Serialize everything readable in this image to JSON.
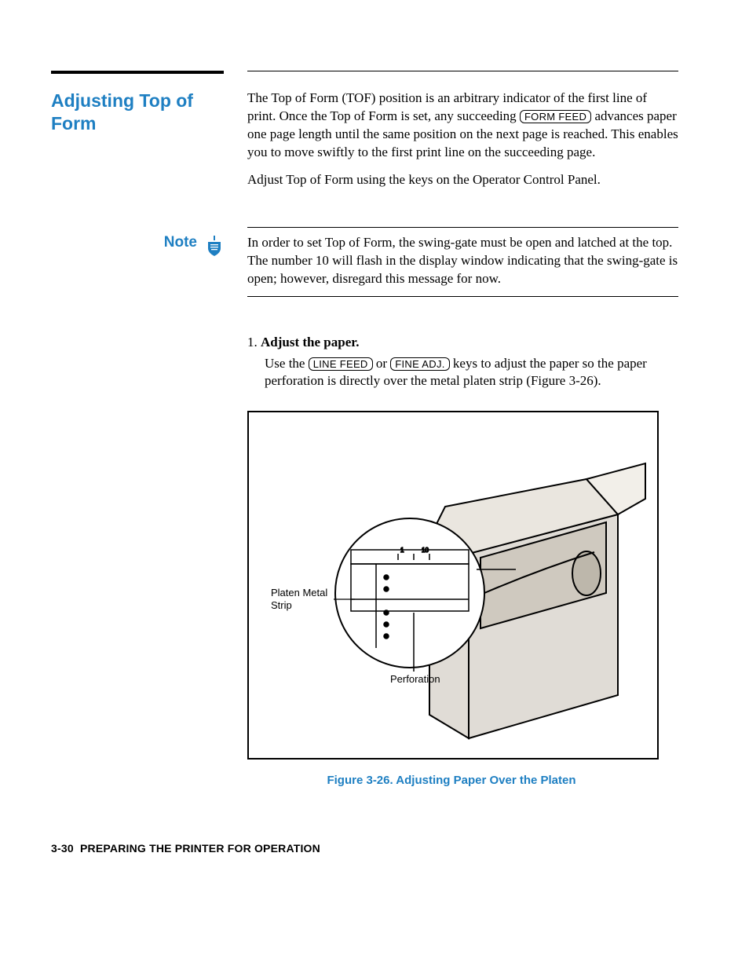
{
  "heading": "Adjusting Top of Form",
  "intro": {
    "p1a": "The Top of Form (TOF) position is an arbitrary indicator of the first line of print. Once the Top of Form is set, any succeeding ",
    "p1_key": "FORM FEED",
    "p1b": " advances paper one page length until the same position on the next page is reached. This enables you to move swiftly to the first print line on the succeeding page.",
    "p2": "Adjust Top of Form using the keys on the Operator Control Panel."
  },
  "note": {
    "label": "Note",
    "text": "In order to set Top of Form, the swing-gate must be open and latched at the top. The number 10 will flash in the display window indicating that the swing-gate is open; however, disregard this message for now."
  },
  "step1": {
    "num": "1.",
    "title": "Adjust the paper.",
    "body_a": "Use the ",
    "key1": "LINE FEED",
    "body_b": " or ",
    "key2": "FINE ADJ.",
    "body_c": " keys to adjust the paper so the paper perforation is directly over the metal platen strip (Figure 3-26)."
  },
  "figure": {
    "label_platen": "Platen Metal\nStrip",
    "label_perf": "Perforation",
    "caption_num": "Figure 3-26.",
    "caption_title": " Adjusting Paper Over the Platen"
  },
  "footer": {
    "pagenum": "3-30",
    "section": "PREPARING THE PRINTER FOR OPERATION"
  }
}
